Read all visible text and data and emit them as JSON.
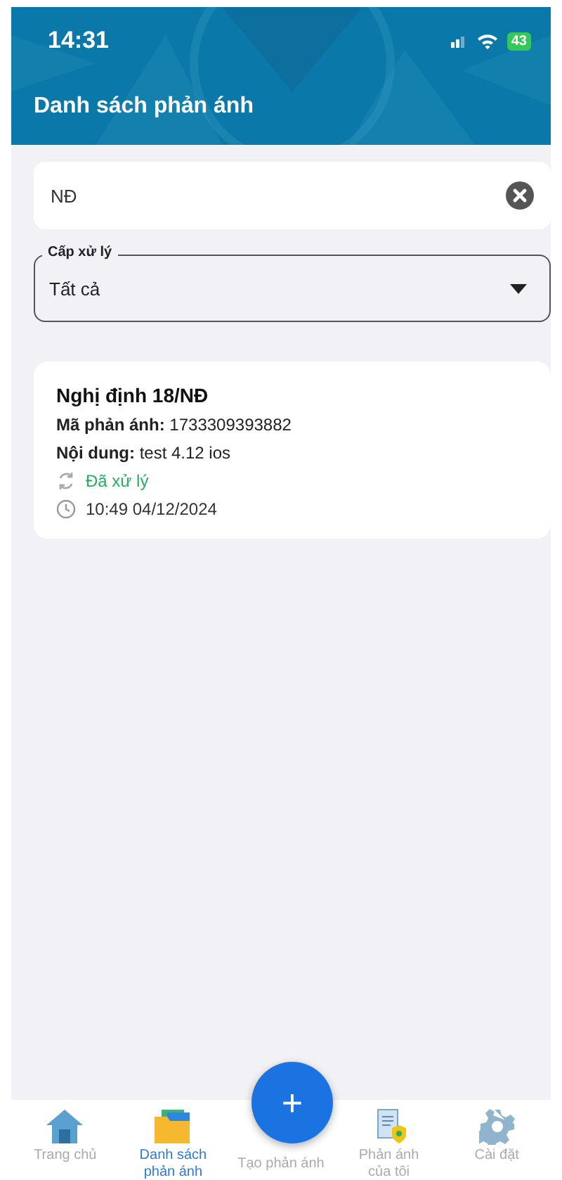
{
  "status_bar": {
    "time": "14:31",
    "battery": "43"
  },
  "header": {
    "title": "Danh sách phản ánh"
  },
  "search": {
    "value": "NĐ"
  },
  "filter": {
    "label": "Cấp xử lý",
    "value": "Tất cả"
  },
  "reports": [
    {
      "title": "Nghị định 18/NĐ",
      "code_label": "Mã phản ánh:",
      "code": "1733309393882",
      "content_label": "Nội dung:",
      "content": "test 4.12 ios",
      "status": "Đã xử lý",
      "time": "10:49 04/12/2024"
    }
  ],
  "fab": {
    "label": "+"
  },
  "nav": [
    {
      "label": "Trang chủ",
      "selected": false
    },
    {
      "label": "Danh sách phản ánh",
      "selected": true
    },
    {
      "label": "Tạo phản ánh",
      "selected": false
    },
    {
      "label": "Phản ánh của tôi",
      "selected": false
    },
    {
      "label": "Cài đặt",
      "selected": false
    }
  ]
}
